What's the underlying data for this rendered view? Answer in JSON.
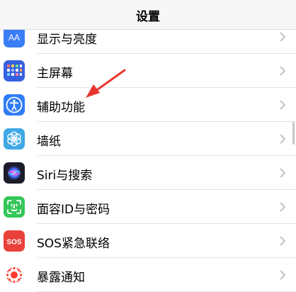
{
  "nav": {
    "title": "设置"
  },
  "items": [
    {
      "label": "显示与亮度",
      "icon": "display-brightness-icon",
      "color": "#3a7ef7"
    },
    {
      "label": "主屏幕",
      "icon": "home-screen-icon",
      "color": "#3660e0"
    },
    {
      "label": "辅助功能",
      "icon": "accessibility-icon",
      "color": "#2f7cf6"
    },
    {
      "label": "墙纸",
      "icon": "wallpaper-icon",
      "color": "#41a8e6"
    },
    {
      "label": "Siri与搜索",
      "icon": "siri-icon",
      "color": "#1c1c2a"
    },
    {
      "label": "面容ID与密码",
      "icon": "face-id-icon",
      "color": "#34c759"
    },
    {
      "label": "SOS紧急联络",
      "icon": "sos-icon",
      "color": "#e8423a"
    },
    {
      "label": "暴露通知",
      "icon": "exposure-notification-icon",
      "color": "#ffffff"
    }
  ],
  "icon_text": {
    "display": "AA",
    "sos": "SOS"
  },
  "annotation": {
    "color": "#e8362f"
  }
}
